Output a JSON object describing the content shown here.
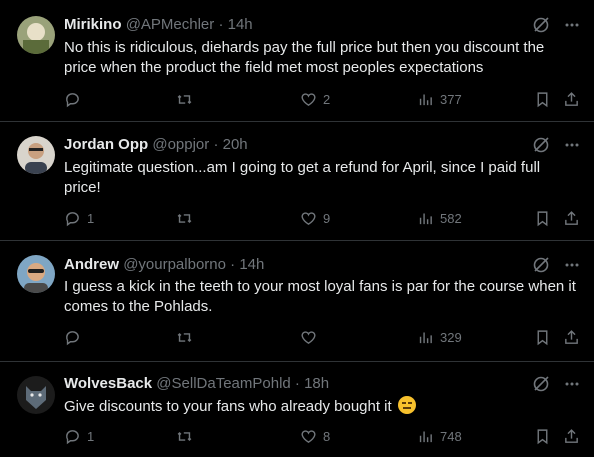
{
  "tweets": [
    {
      "name": "Mirikino",
      "handle": "@APMechler",
      "dot": "·",
      "time": "14h",
      "text": "No this is ridiculous, diehards pay the full price but then you discount the price when the product the field met most peoples expectations",
      "replies": "",
      "reposts": "",
      "likes": "2",
      "views": "377",
      "avatar_color": "#7a8a5a"
    },
    {
      "name": "Jordan Opp",
      "handle": "@oppjor",
      "dot": "·",
      "time": "20h",
      "text": "Legitimate question...am I going to get a refund for April, since I paid full price!",
      "replies": "1",
      "reposts": "",
      "likes": "9",
      "views": "582",
      "avatar_color": "#c9c6c0"
    },
    {
      "name": "Andrew",
      "handle": "@yourpalborno",
      "dot": "·",
      "time": "14h",
      "text": "I guess a kick in the teeth to your most loyal fans is par for the course when it comes to the Pohlads.",
      "replies": "",
      "reposts": "",
      "likes": "",
      "views": "329",
      "avatar_color": "#6a8fb0"
    },
    {
      "name": "WolvesBack",
      "handle": "@SellDaTeamPohld",
      "dot": "·",
      "time": "18h",
      "text": "Give discounts to your fans who already bought it",
      "emoji": "expressionless-face",
      "replies": "1",
      "reposts": "",
      "likes": "8",
      "views": "748",
      "avatar_color": "#2b2b2b"
    }
  ],
  "colors": {
    "background": "#000000",
    "text": "#e7e9ea",
    "secondary": "#71767b",
    "divider": "#2f3336"
  }
}
